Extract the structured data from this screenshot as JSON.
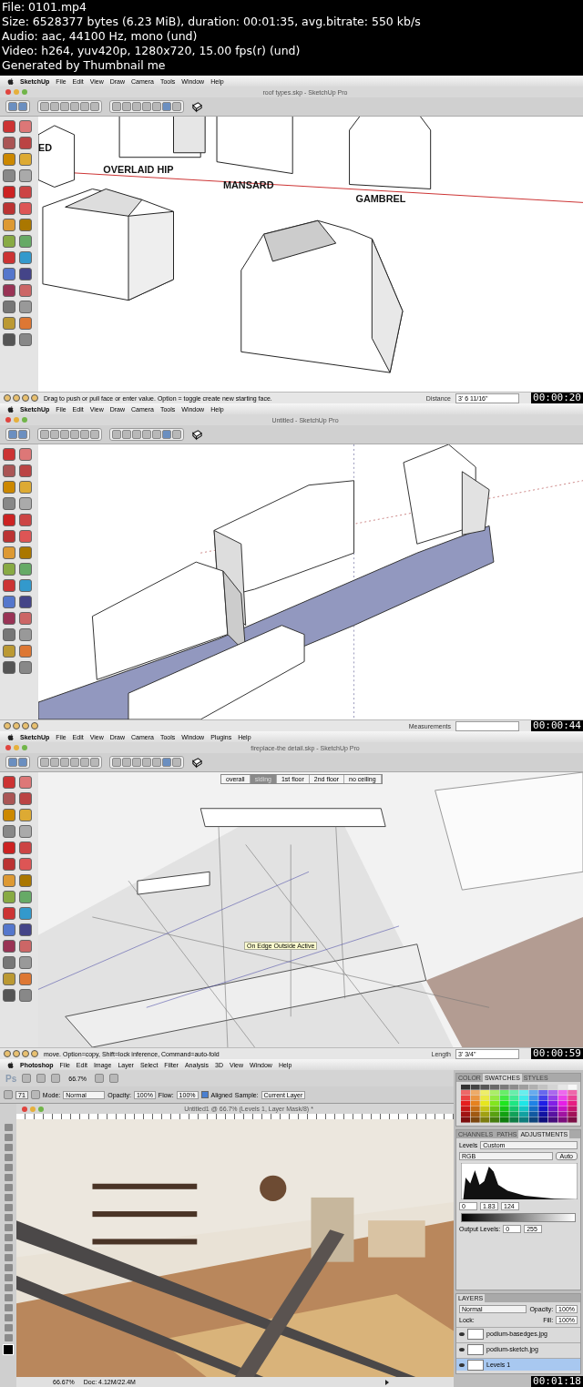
{
  "header": {
    "lines": [
      "File: 0101.mp4",
      "Size: 6528377 bytes (6.23 MiB), duration: 00:01:35, avg.bitrate: 550 kb/s",
      "Audio: aac, 44100 Hz, mono (und)",
      "Video: h264, yuv420p, 1280x720, 15.00 fps(r) (und)",
      "Generated by Thumbnail me"
    ]
  },
  "frames": [
    {
      "kind": "sketchup",
      "menu": [
        "SketchUp",
        "File",
        "Edit",
        "View",
        "Draw",
        "Camera",
        "Tools",
        "Window",
        "Help"
      ],
      "title": "roof types.skp - SketchUp Pro",
      "model_labels": [
        "ED",
        "OVERLAID HIP",
        "MANSARD",
        "GAMBREL"
      ],
      "status_text": "Drag to push or pull face or enter value.  Option = toggle create new starting face.",
      "measure_label": "Distance",
      "measure_value": "3' 6 11/16\"",
      "timestamp": "00:00:20"
    },
    {
      "kind": "sketchup",
      "menu": [
        "SketchUp",
        "File",
        "Edit",
        "View",
        "Draw",
        "Camera",
        "Tools",
        "Window",
        "Help"
      ],
      "title": "Untitled - SketchUp Pro",
      "measure_label": "Measurements",
      "timestamp": "00:00:44"
    },
    {
      "kind": "sketchup",
      "menu": [
        "SketchUp",
        "File",
        "Edit",
        "View",
        "Draw",
        "Camera",
        "Tools",
        "Window",
        "Plugins",
        "Help"
      ],
      "title": "fireplace-the detail.skp - SketchUp Pro",
      "scene_tabs": [
        {
          "label": "overall",
          "selected": false
        },
        {
          "label": "siding",
          "selected": true
        },
        {
          "label": "1st floor",
          "selected": false
        },
        {
          "label": "2nd floor",
          "selected": false
        },
        {
          "label": "no ceiling",
          "selected": false
        }
      ],
      "tooltip": "On Edge Outside Active",
      "status_text": "move.  Option=copy, Shift=lock inference, Command=auto-fold",
      "measure_label": "Length",
      "measure_value": "3' 3/4\"",
      "timestamp": "00:00:59"
    },
    {
      "kind": "photoshop",
      "menu": [
        "Photoshop",
        "File",
        "Edit",
        "Image",
        "Layer",
        "Select",
        "Filter",
        "Analysis",
        "3D",
        "View",
        "Window",
        "Help"
      ],
      "app_logo": "Ps",
      "zoom": "66.7%",
      "options": {
        "brush_size": "71",
        "mode_label": "Mode:",
        "mode": "Normal",
        "opacity_label": "Opacity:",
        "opacity": "100%",
        "flow_label": "Flow:",
        "flow": "100%",
        "aligned_label": "Aligned",
        "aligned": true,
        "sample_label": "Sample:",
        "sample": "Current Layer"
      },
      "document": {
        "title": "Untitled1 @ 66.7% (Levels 1, Layer Mask/8) *",
        "zoom": "66.67%",
        "doc_size": "Doc: 4.12M/22.4M"
      },
      "panels": {
        "swatch_tabs": [
          {
            "label": "COLOR",
            "selected": false
          },
          {
            "label": "SWATCHES",
            "selected": true
          },
          {
            "label": "STYLES",
            "selected": false
          }
        ],
        "adjustment_tabs": [
          {
            "label": "CHANNELS",
            "selected": false
          },
          {
            "label": "PATHS",
            "selected": false
          },
          {
            "label": "ADJUSTMENTS",
            "selected": true
          }
        ],
        "levels_label": "Levels",
        "preset": "Custom",
        "channel": "RGB",
        "auto": "Auto",
        "input_levels": [
          "0",
          "1.83",
          "124"
        ],
        "output_label": "Output Levels:",
        "output_levels": [
          "0",
          "255"
        ],
        "layers_tab": "LAYERS",
        "blend_mode": "Normal",
        "opacity_label": "Opacity:",
        "opacity": "100%",
        "lock_label": "Lock:",
        "fill_label": "Fill:",
        "fill": "100%",
        "layers": [
          {
            "name": "podium-basedges.jpg",
            "selected": false
          },
          {
            "name": "podium-sketch.jpg",
            "selected": false
          },
          {
            "name": "Levels 1",
            "selected": true
          }
        ]
      },
      "timestamp": "00:01:18"
    }
  ]
}
